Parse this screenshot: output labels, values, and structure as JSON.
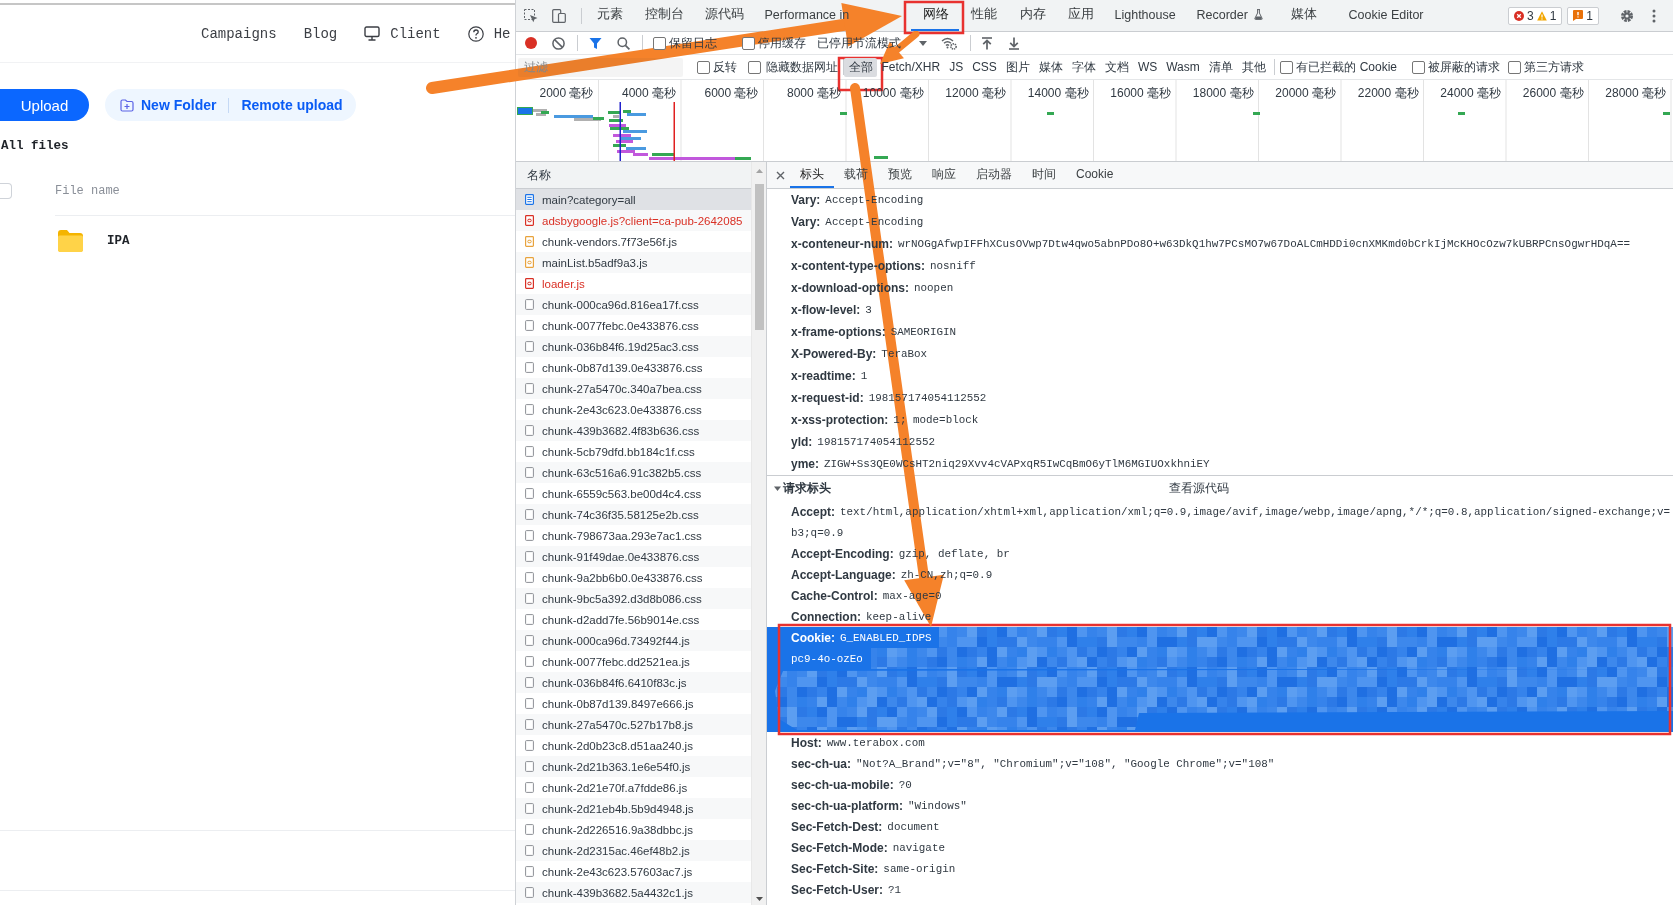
{
  "page": {
    "nav": [
      {
        "label": "Campaigns",
        "kind": "text"
      },
      {
        "label": "Blog",
        "kind": "text"
      },
      {
        "label": "Client",
        "kind": "client"
      },
      {
        "label": "He",
        "kind": "help"
      }
    ],
    "upload_button": "Upload",
    "actions": [
      {
        "label": "New Folder",
        "kind": "new-folder"
      },
      {
        "label": "Remote upload",
        "kind": "text"
      }
    ],
    "breadcrumb": "All files",
    "file_table": {
      "select_all": {
        "checked": false
      },
      "columns": [
        "File name"
      ],
      "rows": [
        {
          "name": "IPA",
          "kind": "folder"
        }
      ]
    }
  },
  "devtools": {
    "panel_tabs": [
      {
        "label": "元素",
        "kind": "plain",
        "selected": false
      },
      {
        "label": "控制台",
        "kind": "plain",
        "selected": false
      },
      {
        "label": "源代码",
        "kind": "plain",
        "selected": false
      },
      {
        "label": "Performance in",
        "kind": "plain",
        "selected": false
      },
      {
        "label": "网络",
        "kind": "plain",
        "selected": true
      },
      {
        "label": "性能",
        "kind": "plain",
        "selected": false
      },
      {
        "label": "内存",
        "kind": "plain",
        "selected": false
      },
      {
        "label": "应用",
        "kind": "plain",
        "selected": false
      },
      {
        "label": "Lighthouse",
        "kind": "plain",
        "selected": false
      },
      {
        "label": "Recorder",
        "kind": "experiment",
        "selected": false
      },
      {
        "label": "媒体",
        "kind": "plain",
        "selected": false
      },
      {
        "label": "Cookie Editor",
        "kind": "plain",
        "selected": false
      }
    ],
    "issues": {
      "errors": "3",
      "warnings": "1",
      "messages": "1"
    },
    "toolbar": {
      "recording": true,
      "preserve_log": {
        "label": "保留日志",
        "checked": false
      },
      "disable_cache": {
        "label": "停用缓存",
        "checked": false
      },
      "throttling": "已停用节流模式"
    },
    "filter_bar": {
      "placeholder": "过滤",
      "invert": {
        "label": "反转",
        "checked": false
      },
      "hide_data_urls": {
        "label": "隐藏数据网址",
        "checked": false
      },
      "types": [
        {
          "label": "全部",
          "selected": true
        },
        {
          "label": "Fetch/XHR",
          "selected": false
        },
        {
          "label": "JS",
          "selected": false
        },
        {
          "label": "CSS",
          "selected": false
        },
        {
          "label": "图片",
          "selected": false
        },
        {
          "label": "媒体",
          "selected": false
        },
        {
          "label": "字体",
          "selected": false
        },
        {
          "label": "文档",
          "selected": false
        },
        {
          "label": "WS",
          "selected": false
        },
        {
          "label": "Wasm",
          "selected": false
        },
        {
          "label": "清单",
          "selected": false
        },
        {
          "label": "其他",
          "selected": false
        }
      ],
      "options": [
        {
          "label": "有已拦截的 Cookie",
          "checked": false
        },
        {
          "label": "被屏蔽的请求",
          "checked": false
        },
        {
          "label": "第三方请求",
          "checked": false
        }
      ]
    },
    "overview": {
      "ticks": [
        "2000 毫秒",
        "4000 毫秒",
        "6000 毫秒",
        "8000 毫秒",
        "10000 毫秒",
        "12000 毫秒",
        "14000 毫秒",
        "16000 毫秒",
        "18000 毫秒",
        "20000 毫秒",
        "22000 毫秒",
        "24000 毫秒",
        "26000 毫秒",
        "28000 毫秒"
      ]
    },
    "requests": {
      "column": "名称",
      "rows": [
        {
          "name": "main?category=all",
          "kind": "document",
          "failed": false,
          "selected": true
        },
        {
          "name": "adsbygoogle.js?client=ca-pub-2642085",
          "kind": "script",
          "failed": true,
          "selected": false
        },
        {
          "name": "chunk-vendors.7f73e56f.js",
          "kind": "script",
          "failed": false,
          "selected": false
        },
        {
          "name": "mainList.b5adf9a3.js",
          "kind": "script",
          "failed": false,
          "selected": false
        },
        {
          "name": "loader.js",
          "kind": "script",
          "failed": true,
          "selected": false
        },
        {
          "name": "chunk-000ca96d.816ea17f.css",
          "kind": "generic",
          "failed": false,
          "selected": false
        },
        {
          "name": "chunk-0077febc.0e433876.css",
          "kind": "generic",
          "failed": false,
          "selected": false
        },
        {
          "name": "chunk-036b84f6.19d25ac3.css",
          "kind": "generic",
          "failed": false,
          "selected": false
        },
        {
          "name": "chunk-0b87d139.0e433876.css",
          "kind": "generic",
          "failed": false,
          "selected": false
        },
        {
          "name": "chunk-27a5470c.340a7bea.css",
          "kind": "generic",
          "failed": false,
          "selected": false
        },
        {
          "name": "chunk-2e43c623.0e433876.css",
          "kind": "generic",
          "failed": false,
          "selected": false
        },
        {
          "name": "chunk-439b3682.4f83b636.css",
          "kind": "generic",
          "failed": false,
          "selected": false
        },
        {
          "name": "chunk-5cb79dfd.bb184c1f.css",
          "kind": "generic",
          "failed": false,
          "selected": false
        },
        {
          "name": "chunk-63c516a6.91c382b5.css",
          "kind": "generic",
          "failed": false,
          "selected": false
        },
        {
          "name": "chunk-6559c563.be00d4c4.css",
          "kind": "generic",
          "failed": false,
          "selected": false
        },
        {
          "name": "chunk-74c36f35.58125e2b.css",
          "kind": "generic",
          "failed": false,
          "selected": false
        },
        {
          "name": "chunk-798673aa.293e7ac1.css",
          "kind": "generic",
          "failed": false,
          "selected": false
        },
        {
          "name": "chunk-91f49dae.0e433876.css",
          "kind": "generic",
          "failed": false,
          "selected": false
        },
        {
          "name": "chunk-9a2bb6b0.0e433876.css",
          "kind": "generic",
          "failed": false,
          "selected": false
        },
        {
          "name": "chunk-9bc5a392.d3d8b086.css",
          "kind": "generic",
          "failed": false,
          "selected": false
        },
        {
          "name": "chunk-d2add7fe.56b9014e.css",
          "kind": "generic",
          "failed": false,
          "selected": false
        },
        {
          "name": "chunk-000ca96d.73492f44.js",
          "kind": "generic",
          "failed": false,
          "selected": false
        },
        {
          "name": "chunk-0077febc.dd2521ea.js",
          "kind": "generic",
          "failed": false,
          "selected": false
        },
        {
          "name": "chunk-036b84f6.6410f83c.js",
          "kind": "generic",
          "failed": false,
          "selected": false
        },
        {
          "name": "chunk-0b87d139.8497e666.js",
          "kind": "generic",
          "failed": false,
          "selected": false
        },
        {
          "name": "chunk-27a5470c.527b17b8.js",
          "kind": "generic",
          "failed": false,
          "selected": false
        },
        {
          "name": "chunk-2d0b23c8.d51aa240.js",
          "kind": "generic",
          "failed": false,
          "selected": false
        },
        {
          "name": "chunk-2d21b363.1e6e54f0.js",
          "kind": "generic",
          "failed": false,
          "selected": false
        },
        {
          "name": "chunk-2d21e70f.a7fdde86.js",
          "kind": "generic",
          "failed": false,
          "selected": false
        },
        {
          "name": "chunk-2d21eb4b.5b9d4948.js",
          "kind": "generic",
          "failed": false,
          "selected": false
        },
        {
          "name": "chunk-2d226516.9a38dbbc.js",
          "kind": "generic",
          "failed": false,
          "selected": false
        },
        {
          "name": "chunk-2d2315ac.46ef48b2.js",
          "kind": "generic",
          "failed": false,
          "selected": false
        },
        {
          "name": "chunk-2e43c623.57603ac7.js",
          "kind": "generic",
          "failed": false,
          "selected": false
        },
        {
          "name": "chunk-439b3682.5a4432c1.js",
          "kind": "generic",
          "failed": false,
          "selected": false
        }
      ]
    },
    "details": {
      "tabs": [
        {
          "label": "标头",
          "selected": true
        },
        {
          "label": "载荷",
          "selected": false
        },
        {
          "label": "预览",
          "selected": false
        },
        {
          "label": "响应",
          "selected": false
        },
        {
          "label": "启动器",
          "selected": false
        },
        {
          "label": "时间",
          "selected": false
        },
        {
          "label": "Cookie",
          "selected": false
        }
      ],
      "response_headers": [
        {
          "name": "Vary:",
          "value": "Accept-Encoding"
        },
        {
          "name": "Vary:",
          "value": "Accept-Encoding"
        },
        {
          "name": "x-conteneur-num:",
          "value": "wrNOGgAfwpIFFhXCusOVwp7Dtw4qwo5abnPDo8O+w63DkQ1hw7PCsMO7w67DoALCmHDDi0cnXMKmd0bCrkIjMcKHOcOzw7kUBRPCnsOgwrHDqA=="
        },
        {
          "name": "x-content-type-options:",
          "value": "nosniff"
        },
        {
          "name": "x-download-options:",
          "value": "noopen"
        },
        {
          "name": "x-flow-level:",
          "value": "3"
        },
        {
          "name": "x-frame-options:",
          "value": "SAMEORIGIN"
        },
        {
          "name": "X-Powered-By:",
          "value": "TeraBox"
        },
        {
          "name": "x-readtime:",
          "value": "1"
        },
        {
          "name": "x-request-id:",
          "value": "198157174054112552"
        },
        {
          "name": "x-xss-protection:",
          "value": "1; mode=block"
        },
        {
          "name": "yld:",
          "value": "198157174054112552"
        },
        {
          "name": "yme:",
          "value": "ZIGW+Ss3QE0WCsHT2niq29Xvv4cVAPxqR5IwCqBmO6yTlM6MGIUOxkhniEY"
        }
      ],
      "request_section": {
        "title": "请求标头",
        "expanded": true,
        "view_source": "查看源代码"
      },
      "request_headers": [
        {
          "name": "Accept:",
          "value": "text/html,application/xhtml+xml,application/xml;q=0.9,image/avif,image/webp,image/apng,*/*;q=0.8,application/signed-exchange;v=",
          "continuation": "b3;q=0.9",
          "selected": false,
          "redacted": false
        },
        {
          "name": "Accept-Encoding:",
          "value": "gzip, deflate, br",
          "selected": false,
          "redacted": false
        },
        {
          "name": "Accept-Language:",
          "value": "zh-CN,zh;q=0.9",
          "selected": false,
          "redacted": false
        },
        {
          "name": "Cache-Control:",
          "value": "max-age=0",
          "selected": false,
          "redacted": false
        },
        {
          "name": "Connection:",
          "value": "keep-alive",
          "selected": false,
          "redacted": false
        },
        {
          "name": "Cookie:",
          "value": "G_ENABLED_IDPS",
          "continuation": "pc9-4o-ozEo",
          "selected": true,
          "redacted": true
        },
        {
          "name": "Host:",
          "value": "www.terabox.com",
          "selected": false,
          "redacted": false
        },
        {
          "name": "sec-ch-ua:",
          "value": "\"Not?A_Brand\";v=\"8\", \"Chromium\";v=\"108\", \"Google Chrome\";v=\"108\"",
          "selected": false,
          "redacted": false
        },
        {
          "name": "sec-ch-ua-mobile:",
          "value": "?0",
          "selected": false,
          "redacted": false
        },
        {
          "name": "sec-ch-ua-platform:",
          "value": "\"Windows\"",
          "selected": false,
          "redacted": false
        },
        {
          "name": "Sec-Fetch-Dest:",
          "value": "document",
          "selected": false,
          "redacted": false
        },
        {
          "name": "Sec-Fetch-Mode:",
          "value": "navigate",
          "selected": false,
          "redacted": false
        },
        {
          "name": "Sec-Fetch-Site:",
          "value": "same-origin",
          "selected": false,
          "redacted": false
        },
        {
          "name": "Sec-Fetch-User:",
          "value": "?1",
          "selected": false,
          "redacted": false
        }
      ]
    }
  }
}
